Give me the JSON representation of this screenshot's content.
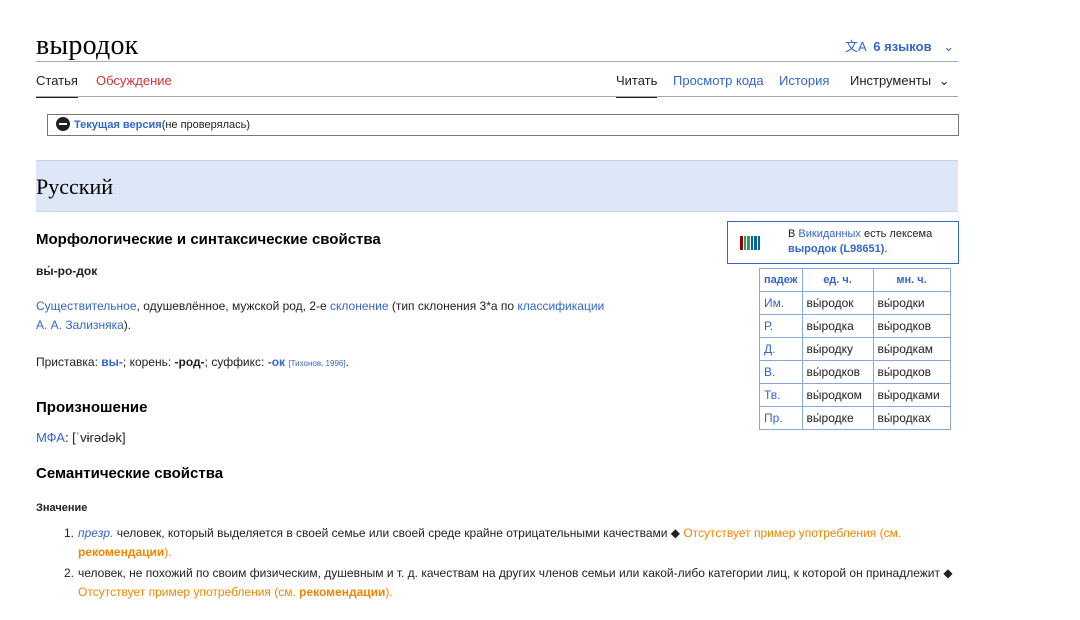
{
  "page": {
    "title": "выродок",
    "languages": "6 языков",
    "languages_icon": "translate-icon"
  },
  "tabs": {
    "article": "Статья",
    "discussion": "Обсуждение",
    "read": "Читать",
    "view_source": "Просмотр кода",
    "history": "История",
    "tools": "Инструменты"
  },
  "version": {
    "current": "Текущая версия",
    "status": "(не проверялась)"
  },
  "language_section": "Русский",
  "morph": {
    "heading": "Морфологические и синтаксические свойства",
    "syllables": "вы́-ро-док",
    "pos": "Существительное",
    "desc1": ", одушевлённое, мужской род, 2-е ",
    "declension": "склонение",
    "desc2": " (тип склонения 3*a по ",
    "classification": "классификации",
    "zaliznyak": "А. А. Зализняка",
    "desc3": ").",
    "prefix_label": "Приставка: ",
    "prefix": "вы-",
    "root_label": "; корень: ",
    "root": "-род-",
    "suffix_label": "; суффикс: ",
    "suffix": "-ок",
    "source": "[Тихонов, 1996]",
    "end": "."
  },
  "wikidata": {
    "text1_a": "В ",
    "text1_link": "Викиданных",
    "text1_b": " есть лексема",
    "lexeme": "выродок (L98651)",
    "lexeme_end": "."
  },
  "declension_table": {
    "headers": [
      "падеж",
      "ед. ч.",
      "мн. ч."
    ],
    "rows": [
      [
        "Им.",
        "вы́родок",
        "вы́родки"
      ],
      [
        "Р.",
        "вы́родка",
        "вы́родков"
      ],
      [
        "Д.",
        "вы́родку",
        "вы́родкам"
      ],
      [
        "В.",
        "вы́родков",
        "вы́родков"
      ],
      [
        "Тв.",
        "вы́родком",
        "вы́родками"
      ],
      [
        "Пр.",
        "вы́родке",
        "вы́родках"
      ]
    ]
  },
  "pronunciation": {
    "heading": "Произношение",
    "ipa_label": "МФА",
    "ipa": ": [ˈvɨrədək]"
  },
  "semantic": {
    "heading": "Семантические свойства",
    "meaning_heading": "Значение",
    "items": [
      {
        "num": "1.",
        "label": "презр.",
        "text": " человек, который выделяется в своей семье или своей среде крайне отрицательными качествами ◆ ",
        "missing": "Отсутствует пример употребления (см. ",
        "rec": "рекомендации",
        "close": ")."
      },
      {
        "num": "2.",
        "text": "человек, не похожий по своим физическим, душевным и т. д. качествам на других членов семьи или какой-либо категории лиц, к которой он принадлежит ◆ ",
        "missing": "Отсутствует пример употребления (см. ",
        "rec": "рекомендации",
        "close": ")."
      }
    ]
  }
}
